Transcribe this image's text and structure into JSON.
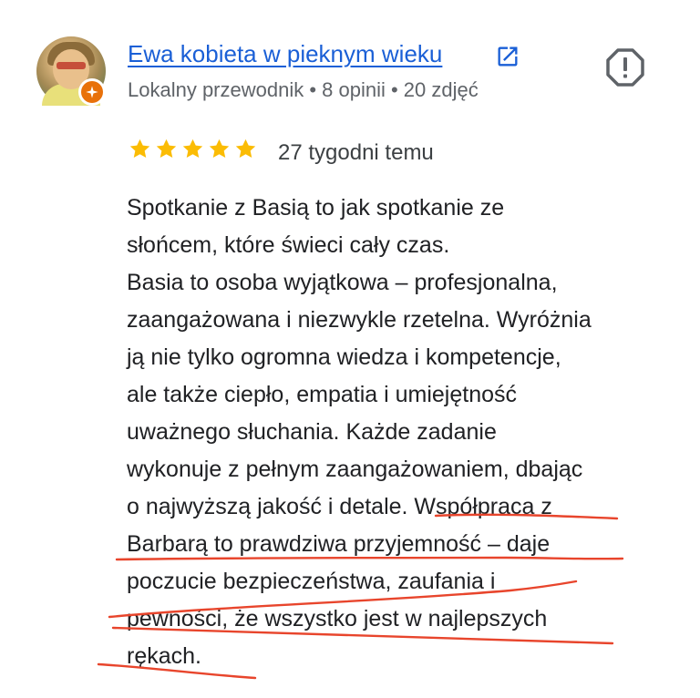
{
  "author": {
    "name": "Ewa kobieta w pieknym wieku",
    "meta": "Lokalny przewodnik • 8 opinii • 20 zdjęć"
  },
  "review": {
    "rating": 5,
    "rating_max": 5,
    "time_ago": "27 tygodni temu",
    "text_lines": [
      "Spotkanie z Basią to jak spotkanie ze",
      "słońcem, które świeci cały czas.",
      "Basia to osoba wyjątkowa – profesjonalna,",
      "zaangażowana i niezwykle rzetelna. Wyróżnia",
      "ją nie tylko ogromna wiedza i kompetencje,",
      "ale także ciepło, empatia i umiejętność",
      "uważnego słuchania. Każde zadanie",
      "wykonuje z pełnym zaangażowaniem, dbając",
      "o najwyższą jakość i detale. Współpraca z",
      "Barbarą to prawdziwa przyjemność – daje",
      "poczucie bezpieczeństwa, zaufania i",
      "pewności, że wszystko jest w najlepszych",
      "rękach."
    ]
  },
  "colors": {
    "link": "#1a5fd6",
    "star": "#fbbc04",
    "meta_text": "#5f6368",
    "body_text": "#202124",
    "badge": "#e8710a",
    "annotation": "#e8452c"
  },
  "icons": {
    "external_link": "open-in-new-icon",
    "report": "report-flag-icon",
    "guide_badge": "local-guide-star-icon"
  }
}
